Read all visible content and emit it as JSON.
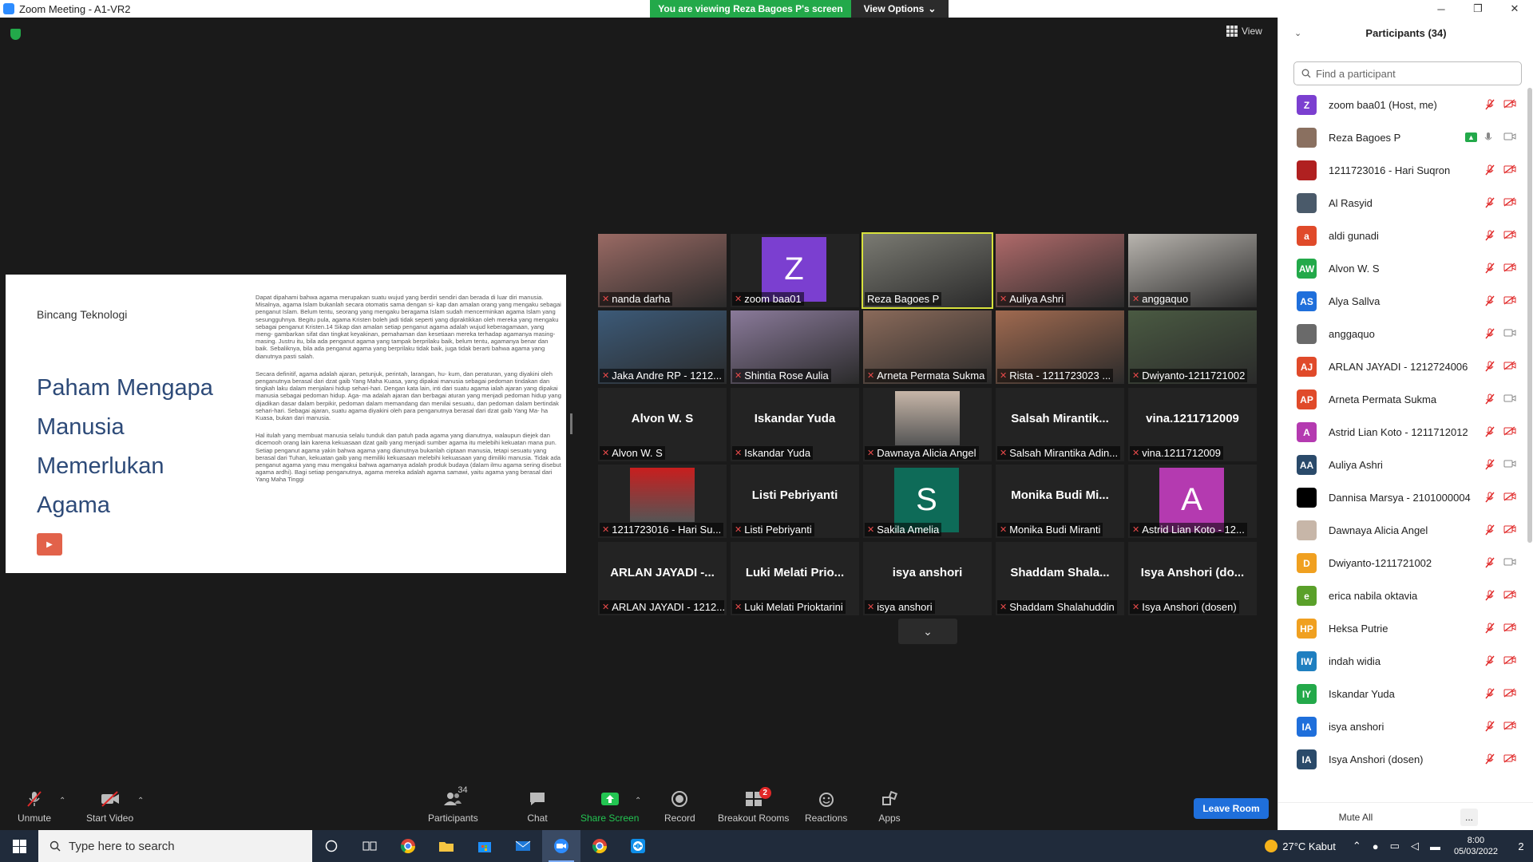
{
  "window": {
    "title": "Zoom Meeting - A1-VR2",
    "minimize": "─",
    "maximize": "❐",
    "close": "✕"
  },
  "share_banner": {
    "viewing_text": "You are viewing Reza Bagoes P's screen",
    "view_options": "View Options",
    "view_options_caret": "⌄"
  },
  "view_button": {
    "label": "View"
  },
  "slide": {
    "brand": "Bincang Teknologi",
    "headline": "Paham Mengapa Manusia Memerlukan Agama",
    "play": "▶",
    "paragraphs": [
      "Dapat dipahami bahwa agama merupakan suatu wujud yang berdiri sendiri dan berada di luar diri manusia. Misalnya, agama Islam bukanlah secara otomatis sama dengan si- kap dan amalan orang yang mengaku sebagai penganut Islam. Belum tentu, seorang yang mengaku beragama Islam sudah mencerminkan agama Islam yang sesungguhnya. Begitu pula, agama Kristen boleh jadi tidak seperti yang dipraktikkan oleh mereka yang mengaku sebagai penganut Kristen.14 Sikap dan amalan setiap penganut agama adalah wujud keberagamaan, yang meng- gambarkan sifat dan tingkat keyakinan, pemahaman dan kesetiaan mereka terhadap agamanya masing-masing. Justru itu, bila ada penganut agama yang tampak berprilaku baik, belum tentu, agamanya benar dan baik. Sebaliknya, bila ada penganut agama yang berprilaku tidak baik, juga tidak berarti bahwa agama yang dianutnya pasti salah.",
      "Secara definitif, agama adalah ajaran, petunjuk, perintah, larangan, hu- kum, dan peraturan, yang diyakini oleh penganutnya berasal dari dzat gaib Yang Maha Kuasa, yang dipakai manusia sebagai pedoman tindakan dan tingkah laku dalam menjalani hidup sehari-hari. Dengan kata lain, inti dari suatu agama ialah ajaran yang dipakai manusia sebagai pedoman hidup. Aga- ma adalah ajaran dan berbagai aturan yang menjadi pedoman hidup yang dijadikan dasar dalam berpikir, pedoman dalam memandang dan menilai sesuatu, dan pedoman dalam bertindak sehari-hari. Sebagai ajaran, suatu agama diyakini oleh para penganutnya berasal dari dzat gaib Yang Ma- ha Kuasa, bukan dari manusia.",
      "Hal itulah yang membuat manusia selalu tunduk dan patuh pada agama yang dianutnya, walaupun diejek dan dicemooh orang lain karena kekuasaan dzat gaib yang menjadi sumber agama itu melebihi kekuatan mana pun. Setiap penganut agama yakin bahwa agama yang dianutnya bukanlah ciptaan manusia, tetapi sesuatu yang berasal dari Tuhan, kekuatan gaib yang memiliki kekuasaan melebihi kekuasaan yang dimiliki manusia. Tidak ada penganut agama yang mau mengakui bahwa agamanya adalah produk budaya (dalam ilmu agama sering disebut agama ardhi). Bagi setiap penganutnya, agama mereka adalah agama samawi, yaitu agama yang berasal dari Yang Maha Tinggi"
    ]
  },
  "tiles": [
    {
      "caption": "nanda darha",
      "kind": "photo",
      "color": "#9a6a64",
      "muted": true
    },
    {
      "caption": "zoom baa01",
      "kind": "avatar",
      "initial": "Z",
      "color": "#7b3fd0",
      "muted": true
    },
    {
      "caption": "Reza Bagoes P",
      "kind": "photo",
      "color": "#7a7a72",
      "muted": false,
      "active": true
    },
    {
      "caption": "Auliya Ashri",
      "kind": "photo",
      "color": "#b06a6a",
      "muted": true
    },
    {
      "caption": "anggaquo",
      "kind": "photo",
      "color": "#b8b4ae",
      "muted": true
    },
    {
      "caption": "Jaka Andre RP - 1212...",
      "kind": "photo",
      "color": "#3c5a78",
      "muted": true
    },
    {
      "caption": "Shintia Rose Aulia",
      "kind": "photo",
      "color": "#8a7a9a",
      "muted": true
    },
    {
      "caption": "Arneta Permata Sukma",
      "kind": "photo",
      "color": "#8a6a5a",
      "muted": true
    },
    {
      "caption": "Rista - 1211723023 ...",
      "kind": "photo",
      "color": "#a06a50",
      "muted": true
    },
    {
      "caption": "Dwiyanto-1211721002",
      "kind": "photo",
      "color": "#4a5a42",
      "muted": true
    },
    {
      "caption": "Alvon W. S",
      "kind": "name",
      "full": "Alvon W. S",
      "muted": true
    },
    {
      "caption": "Iskandar Yuda",
      "kind": "name",
      "full": "Iskandar Yuda",
      "muted": true
    },
    {
      "caption": "Dawnaya Alicia Angel",
      "kind": "smallphoto",
      "color": "#c7b6a8",
      "muted": true
    },
    {
      "caption": "Salsah Mirantika Adin...",
      "kind": "name",
      "full": "Salsah  Mirantik...",
      "muted": true
    },
    {
      "caption": "vina.1211712009",
      "kind": "name",
      "full": "vina.1211712009",
      "muted": true
    },
    {
      "caption": "1211723016 - Hari Su...",
      "kind": "smallphoto",
      "color": "#c81e1e",
      "muted": true
    },
    {
      "caption": "Listi Pebriyanti",
      "kind": "name",
      "full": "Listi Pebriyanti",
      "muted": true
    },
    {
      "caption": "Sakila Amelia",
      "kind": "avatar",
      "initial": "S",
      "color": "#0e6b58",
      "muted": true
    },
    {
      "caption": "Monika Budi Miranti",
      "kind": "name",
      "full": "Monika  Budi  Mi...",
      "muted": true
    },
    {
      "caption": "Astrid Lian Koto - 12...",
      "kind": "avatar",
      "initial": "A",
      "color": "#b43ab0",
      "muted": true
    },
    {
      "caption": "ARLAN JAYADI - 1212...",
      "kind": "name",
      "full": "ARLAN JAYADI -...",
      "muted": true
    },
    {
      "caption": "Luki Melati Prioktarini",
      "kind": "name",
      "full": "Luki  Melati  Prio...",
      "muted": true
    },
    {
      "caption": "isya anshori",
      "kind": "name",
      "full": "isya anshori",
      "muted": true
    },
    {
      "caption": "Shaddam Shalahuddin",
      "kind": "name",
      "full": "Shaddam  Shala...",
      "muted": true
    },
    {
      "caption": "Isya Anshori (dosen)",
      "kind": "name",
      "full": "Isya Anshori (do...",
      "muted": true
    }
  ],
  "toolbar": {
    "unmute": "Unmute",
    "start_video": "Start Video",
    "participants": "Participants",
    "participants_count": "34",
    "chat": "Chat",
    "share_screen": "Share Screen",
    "record": "Record",
    "breakout_rooms": "Breakout Rooms",
    "breakout_badge": "2",
    "reactions": "Reactions",
    "apps": "Apps",
    "leave_room": "Leave Room",
    "caret": "⌃",
    "page_down": "⌄"
  },
  "panel": {
    "title": "Participants (34)",
    "collapse": "⌄",
    "search_placeholder": "Find a participant",
    "mute_all": "Mute All",
    "more": "...",
    "participants": [
      {
        "initials": "Z",
        "color": "#7b3fd0",
        "name": "zoom baa01 (Host, me)",
        "mic": false,
        "video": false
      },
      {
        "initials": "",
        "color": "#8a7060",
        "name": "Reza Bagoes P",
        "mic": true,
        "video": true,
        "sharing": true
      },
      {
        "initials": "",
        "color": "#b02020",
        "name": "1211723016 - Hari Suqron",
        "mic": false,
        "video": false
      },
      {
        "initials": "",
        "color": "#4a5a6a",
        "name": "Al Rasyid",
        "mic": false,
        "video": false
      },
      {
        "initials": "a",
        "color": "#e04a2a",
        "name": "aldi gunadi",
        "mic": false,
        "video": false
      },
      {
        "initials": "AW",
        "color": "#23a94a",
        "name": "Alvon W. S",
        "mic": false,
        "video": false
      },
      {
        "initials": "AS",
        "color": "#1f6fdb",
        "name": "Alya Sallva",
        "mic": false,
        "video": false
      },
      {
        "initials": "",
        "color": "#6a6a6a",
        "name": "anggaquo",
        "mic": false,
        "video": true
      },
      {
        "initials": "AJ",
        "color": "#e04a2a",
        "name": "ARLAN JAYADI - 1212724006",
        "mic": false,
        "video": false
      },
      {
        "initials": "AP",
        "color": "#e04a2a",
        "name": "Arneta Permata Sukma",
        "mic": false,
        "video": true
      },
      {
        "initials": "A",
        "color": "#b43ab0",
        "name": "Astrid Lian Koto - 1211712012",
        "mic": false,
        "video": false
      },
      {
        "initials": "AA",
        "color": "#2a4a6a",
        "name": "Auliya Ashri",
        "mic": false,
        "video": true
      },
      {
        "initials": "",
        "color": "#000000",
        "name": "Dannisa Marsya - 2101000004",
        "mic": false,
        "video": false
      },
      {
        "initials": "",
        "color": "#c7b6a8",
        "name": "Dawnaya Alicia Angel",
        "mic": false,
        "video": false
      },
      {
        "initials": "D",
        "color": "#f0a020",
        "name": "Dwiyanto-1211721002",
        "mic": false,
        "video": true
      },
      {
        "initials": "e",
        "color": "#5aa02a",
        "name": "erica nabila oktavia",
        "mic": false,
        "video": false
      },
      {
        "initials": "HP",
        "color": "#f0a020",
        "name": "Heksa Putrie",
        "mic": false,
        "video": false
      },
      {
        "initials": "IW",
        "color": "#1f7fc0",
        "name": "indah widia",
        "mic": false,
        "video": false
      },
      {
        "initials": "IY",
        "color": "#23a94a",
        "name": "Iskandar Yuda",
        "mic": false,
        "video": false
      },
      {
        "initials": "IA",
        "color": "#1f6fdb",
        "name": "isya anshori",
        "mic": false,
        "video": false
      },
      {
        "initials": "IA",
        "color": "#2a4a6a",
        "name": "Isya Anshori (dosen)",
        "mic": false,
        "video": false
      }
    ]
  },
  "taskbar": {
    "search_placeholder": "Type here to search",
    "weather": "27°C  Kabut",
    "time": "8:00",
    "date": "05/03/2022",
    "notifications": "2"
  }
}
